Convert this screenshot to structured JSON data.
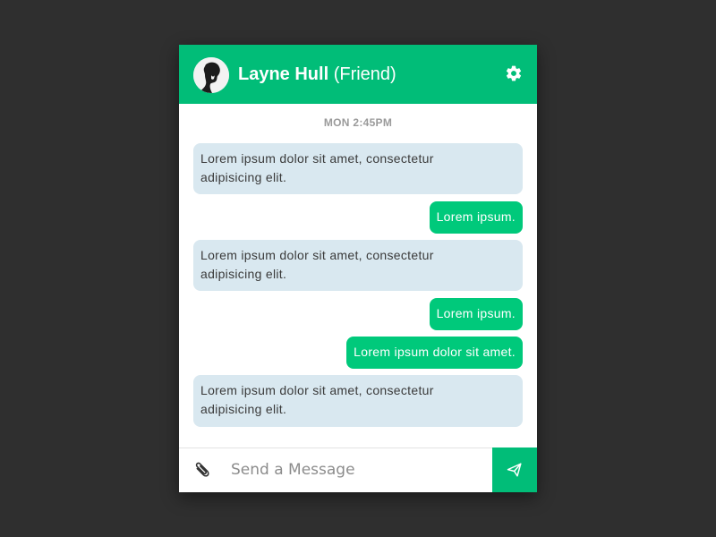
{
  "theme": {
    "accent": "#01bd78",
    "outgoing_bubble": "#00c97b",
    "incoming_bubble": "#d9e8f0",
    "page_background": "#2f2f2f"
  },
  "header": {
    "contact_name": "Layne Hull",
    "relation": "(Friend)",
    "avatar": "user-avatar",
    "settings_icon": "gear-icon"
  },
  "timestamp": "MON 2:45PM",
  "messages": [
    {
      "direction": "incoming",
      "line1": "Lorem ipsum dolor sit amet, consectetur",
      "line2": "adipisicing elit."
    },
    {
      "direction": "outgoing",
      "text": "Lorem ipsum."
    },
    {
      "direction": "incoming",
      "line1": "Lorem ipsum dolor sit amet, consectetur",
      "line2": "adipisicing elit."
    },
    {
      "direction": "outgoing",
      "text": "Lorem ipsum."
    },
    {
      "direction": "outgoing",
      "text": "Lorem ipsum dolor sit amet."
    },
    {
      "direction": "incoming",
      "line1": "Lorem ipsum dolor sit amet, consectetur",
      "line2": "adipisicing elit."
    }
  ],
  "composer": {
    "placeholder": "Send a Message",
    "value": "",
    "attach_icon": "paperclip-icon",
    "send_icon": "paper-plane-icon"
  }
}
